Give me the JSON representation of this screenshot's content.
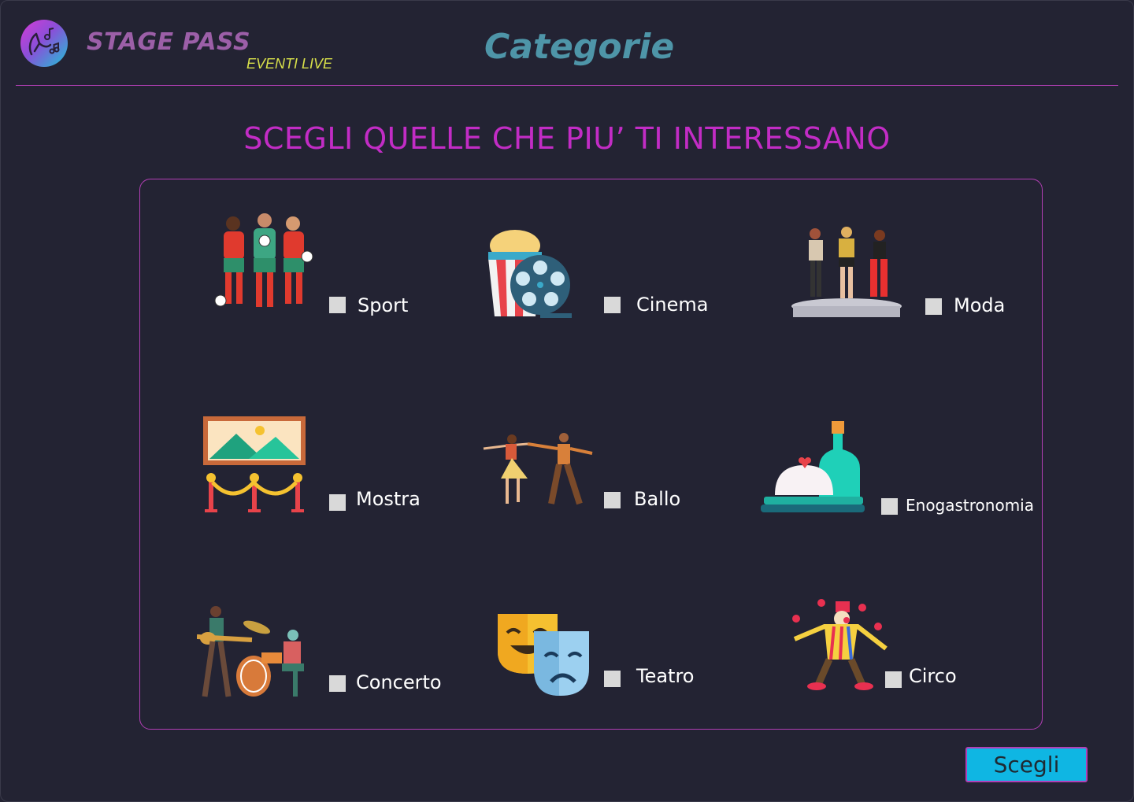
{
  "header": {
    "brand": "STAGE PASS",
    "brand_sub": "EVENTI LIVE",
    "page_title": "Categorie",
    "logo_icon": "music-hand-icon"
  },
  "main": {
    "subtitle": "SCEGLI QUELLE CHE PIU’ TI INTERESSANO"
  },
  "categories": [
    {
      "label": "Sport",
      "icon": "football-players-icon",
      "checked": false
    },
    {
      "label": "Cinema",
      "icon": "popcorn-film-reel-icon",
      "checked": false
    },
    {
      "label": "Moda",
      "icon": "fashion-models-icon",
      "checked": false
    },
    {
      "label": "Mostra",
      "icon": "art-exhibition-icon",
      "checked": false
    },
    {
      "label": "Ballo",
      "icon": "dancing-couple-icon",
      "checked": false
    },
    {
      "label": "Enogastronomia",
      "icon": "food-wine-icon",
      "checked": false
    },
    {
      "label": "Concerto",
      "icon": "band-concert-icon",
      "checked": false
    },
    {
      "label": "Teatro",
      "icon": "theater-masks-icon",
      "checked": false
    },
    {
      "label": "Circo",
      "icon": "juggling-clown-icon",
      "checked": false
    }
  ],
  "footer": {
    "choose_label": "Scegli"
  },
  "colors": {
    "background": "#232333",
    "accent": "#b23fb5",
    "subtitle": "#c22cc5",
    "title": "#4e95a8",
    "brand": "#9c5fa8",
    "brand_sub": "#d8e04a",
    "button": "#0fb6e3"
  }
}
